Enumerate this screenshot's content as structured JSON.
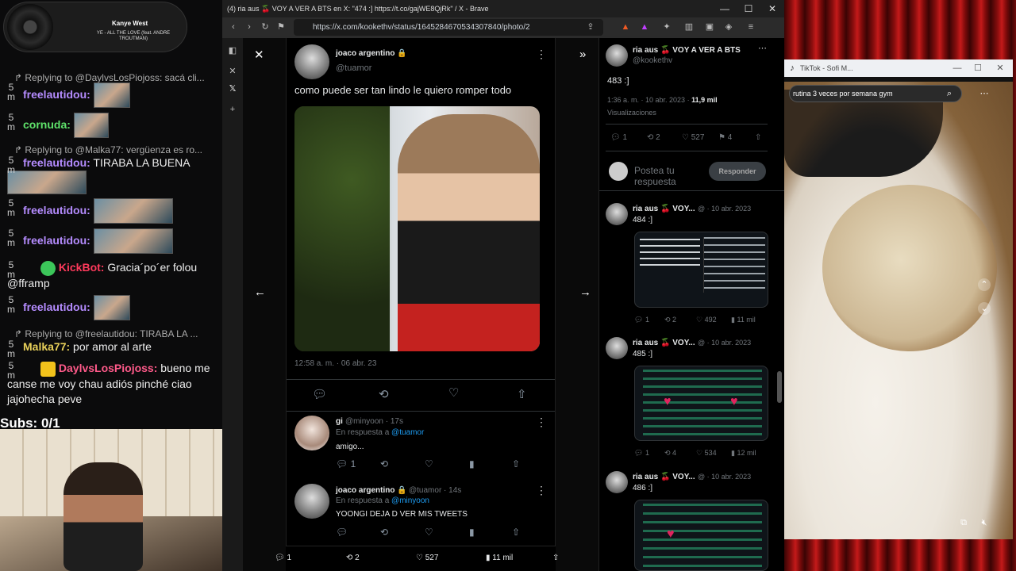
{
  "now_playing": {
    "artist": "Kanye West",
    "song": "YE - ALL THE LOVE (feat. ANDRE TROUTMAN)"
  },
  "chat": {
    "top_reply": "Replying to @DaylvsLosPiojoss: sacá cli...",
    "messages": [
      {
        "time": "5 m",
        "user": "freelautidou:",
        "text": ""
      },
      {
        "time": "5 m",
        "user": "cornuda:",
        "text": ""
      },
      {
        "reply": "Replying to @Malka77: vergüenza es ro...",
        "time": "5 m",
        "user": "freelautidou:",
        "text": "TIRABA LA BUENA"
      },
      {
        "time": "5 m",
        "user": "freelautidou:",
        "text": ""
      },
      {
        "time": "5 m",
        "user": "freelautidou:",
        "text": ""
      },
      {
        "time": "5 m",
        "user": "KickBot:",
        "text": "Gracia´po´er folou @fframp"
      },
      {
        "time": "5 m",
        "user": "freelautidou:",
        "text": ""
      },
      {
        "reply": "Replying to @freelautidou: TIRABA LA ...",
        "time": "5 m",
        "user": "Malka77:",
        "text": "por amor al arte"
      },
      {
        "time": "5 m",
        "user": "DaylvsLosPiojoss:",
        "text": "bueno me canse me voy chau adiós pinché ciao jajohecha peve"
      }
    ]
  },
  "subs": "Subs: 0/1",
  "browser": {
    "title": "(4) ria aus 🍒 VOY A VER A BTS en X: \"474 :] https://t.co/gajWE8QjRk\" / X - Brave",
    "url": "https://x.com/kookethv/status/1645284670534307840/photo/2"
  },
  "post": {
    "author": "joaco argentino",
    "handle": "@tuamor",
    "text": "como puede ser tan lindo le quiero romper todo",
    "timestamp": "12:58 a. m. · 06 abr. 23",
    "replies": [
      {
        "author": "gi",
        "meta": "@minyoon · 17s",
        "reply_to_label": "En respuesta a",
        "reply_to": "@tuamor",
        "text": "amigo...",
        "count": "1"
      },
      {
        "author": "joaco argentino",
        "meta": "@tuamor · 14s",
        "reply_to_label": "En respuesta a",
        "reply_to": "@minyoon",
        "text": "YOONGI DEJA D VER MIS TWEETS"
      }
    ],
    "bottom": {
      "replies": "1",
      "retweets": "2",
      "likes": "527",
      "views": "11 mil"
    }
  },
  "thread": {
    "author": "ria aus 🍒 VOY A VER A BTS",
    "handle": "@kookethv",
    "text": "483 :]",
    "time": "1:36 a. m. · 10 abr. 2023 ·",
    "views": "11,9 mil",
    "views_label": "Visualizaciones",
    "stats": {
      "replies": "1",
      "retweets": "2",
      "likes": "527",
      "bookmarks": "4"
    },
    "reply_placeholder": "Postea tu respuesta",
    "reply_button": "Responder",
    "items": [
      {
        "author": "ria aus 🍒 VOY...",
        "date": "@ · 10 abr. 2023",
        "text": "484 :]",
        "stats": [
          "1",
          "2",
          "492",
          "11 mil"
        ]
      },
      {
        "author": "ria aus 🍒 VOY...",
        "date": "@ · 10 abr. 2023",
        "text": "485 :]",
        "stats": [
          "1",
          "4",
          "534",
          "12 mil"
        ]
      },
      {
        "author": "ria aus 🍒 VOY...",
        "date": "@ · 10 abr. 2023",
        "text": "486 :]"
      }
    ]
  },
  "tiktok": {
    "title": "TikTok - Sofi M...",
    "search": "rutina 3 veces por semana gym"
  }
}
